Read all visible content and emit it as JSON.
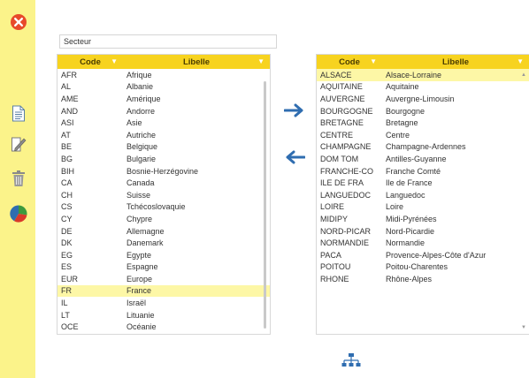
{
  "colors": {
    "sidebar": "#fbf38a",
    "header": "#f7d31f",
    "selected": "#fdf7a6",
    "arrow": "#2f6db0"
  },
  "sidebar": {
    "icons": [
      "close-icon",
      "document-icon",
      "edit-icon",
      "trash-icon",
      "pie-chart-icon"
    ]
  },
  "filter": {
    "value": "Secteur"
  },
  "left_grid": {
    "headers": {
      "code": "Code",
      "libelle": "Libelle"
    },
    "rows": [
      {
        "code": "AFR",
        "libelle": "Afrique"
      },
      {
        "code": "AL",
        "libelle": "Albanie"
      },
      {
        "code": "AME",
        "libelle": "Amérique"
      },
      {
        "code": "AND",
        "libelle": "Andorre"
      },
      {
        "code": "ASI",
        "libelle": "Asie"
      },
      {
        "code": "AT",
        "libelle": "Autriche"
      },
      {
        "code": "BE",
        "libelle": "Belgique"
      },
      {
        "code": "BG",
        "libelle": "Bulgarie"
      },
      {
        "code": "BIH",
        "libelle": "Bosnie-Herzégovine"
      },
      {
        "code": "CA",
        "libelle": "Canada"
      },
      {
        "code": "CH",
        "libelle": "Suisse"
      },
      {
        "code": "CS",
        "libelle": "Tchécoslovaquie"
      },
      {
        "code": "CY",
        "libelle": "Chypre"
      },
      {
        "code": "DE",
        "libelle": "Allemagne"
      },
      {
        "code": "DK",
        "libelle": "Danemark"
      },
      {
        "code": "EG",
        "libelle": "Egypte"
      },
      {
        "code": "ES",
        "libelle": "Espagne"
      },
      {
        "code": "EUR",
        "libelle": "Europe"
      },
      {
        "code": "FR",
        "libelle": "France",
        "selected": true
      },
      {
        "code": "IL",
        "libelle": "Israël"
      },
      {
        "code": "LT",
        "libelle": "Lituanie"
      },
      {
        "code": "OCE",
        "libelle": "Océanie"
      }
    ]
  },
  "right_grid": {
    "headers": {
      "code": "Code",
      "libelle": "Libelle"
    },
    "rows": [
      {
        "code": "ALSACE",
        "libelle": "Alsace-Lorraine",
        "selected": true
      },
      {
        "code": "AQUITAINE",
        "libelle": "Aquitaine"
      },
      {
        "code": "AUVERGNE",
        "libelle": "Auvergne-Limousin"
      },
      {
        "code": "BOURGOGNE",
        "libelle": "Bourgogne"
      },
      {
        "code": "BRETAGNE",
        "libelle": "Bretagne"
      },
      {
        "code": "CENTRE",
        "libelle": "Centre"
      },
      {
        "code": "CHAMPAGNE",
        "libelle": "Champagne-Ardennes"
      },
      {
        "code": "DOM TOM",
        "libelle": "Antilles-Guyanne"
      },
      {
        "code": "FRANCHE-CO",
        "libelle": "Franche Comté"
      },
      {
        "code": "ILE DE FRA",
        "libelle": "Ile de France"
      },
      {
        "code": "LANGUEDOC",
        "libelle": "Languedoc"
      },
      {
        "code": "LOIRE",
        "libelle": "Loire"
      },
      {
        "code": "MIDIPY",
        "libelle": "Midi-Pyrénées"
      },
      {
        "code": "NORD-PICAR",
        "libelle": "Nord-Picardie"
      },
      {
        "code": "NORMANDIE",
        "libelle": "Normandie"
      },
      {
        "code": "PACA",
        "libelle": "Provence-Alpes-Côte d'Azur"
      },
      {
        "code": "POITOU",
        "libelle": "Poitou-Charentes"
      },
      {
        "code": "RHONE",
        "libelle": "Rhône-Alpes"
      }
    ]
  }
}
